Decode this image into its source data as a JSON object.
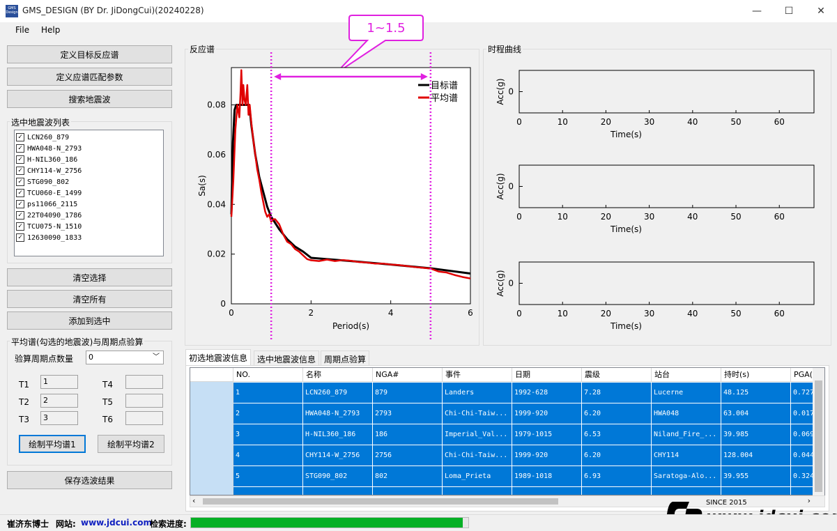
{
  "window": {
    "title": "GMS_DESIGN (BY Dr. JiDongCui)(20240228)",
    "icon_text": "GMS Design",
    "minimize": "—",
    "maximize": "☐",
    "close": "✕"
  },
  "menu": {
    "file": "File",
    "help": "Help"
  },
  "left_panel": {
    "btn_define_target": "定义目标反应谱",
    "btn_define_params": "定义应谱匹配参数",
    "btn_search": "搜索地震波",
    "list_title": "选中地震波列表",
    "waves": [
      "LCN260_879",
      "HWA048-N_2793",
      "H-NIL360_186",
      "CHY114-W_2756",
      "STG090_802",
      "TCU060-E_1499",
      "ps11066_2115",
      "22T04090_1786",
      "TCU075-N_1510",
      "12630090_1833"
    ],
    "btn_clear_selection": "清空选择",
    "btn_clear_all": "清空所有",
    "btn_add_to_selected": "添加到选中",
    "check_group_title": "平均谱(勾选的地震波)与周期点验算",
    "period_count_label": "验算周期点数量",
    "period_count_value": "0",
    "t1_label": "T1",
    "t1_value": "1",
    "t2_label": "T2",
    "t2_value": "2",
    "t3_label": "T3",
    "t3_value": "3",
    "t4_label": "T4",
    "t4_value": "",
    "t5_label": "T5",
    "t5_value": "",
    "t6_label": "T6",
    "t6_value": "",
    "btn_draw_avg1": "绘制平均谱1",
    "btn_draw_avg2": "绘制平均谱2",
    "btn_save": "保存选波结果"
  },
  "spectrum_panel": {
    "title": "反应谱",
    "callout": "1~1.5"
  },
  "chart_data": [
    {
      "type": "line",
      "xlabel": "Period(s)",
      "ylabel": "Sa(s)",
      "xlim": [
        0,
        6
      ],
      "ylim": [
        0,
        0.095
      ],
      "xticks": [
        "0",
        "2",
        "4",
        "6"
      ],
      "yticks": [
        "0",
        "0.02",
        "0.04",
        "0.06",
        "0.08"
      ],
      "legend_position": "top-right",
      "series": [
        {
          "name": "目标谱",
          "color": "#000000",
          "x": [
            0,
            0.04,
            0.08,
            0.12,
            0.2,
            0.45,
            0.5,
            0.6,
            0.7,
            0.8,
            0.9,
            1.0,
            1.2,
            1.4,
            1.6,
            1.8,
            2.0,
            3.0,
            4.0,
            5.0,
            6.0
          ],
          "y": [
            0.036,
            0.065,
            0.078,
            0.08,
            0.08,
            0.08,
            0.072,
            0.06,
            0.051,
            0.045,
            0.039,
            0.035,
            0.03,
            0.026,
            0.023,
            0.021,
            0.0185,
            0.0172,
            0.0158,
            0.0143,
            0.0122
          ]
        },
        {
          "name": "平均谱",
          "color": "#e00000",
          "x": [
            0,
            0.05,
            0.1,
            0.15,
            0.2,
            0.23,
            0.25,
            0.28,
            0.3,
            0.33,
            0.36,
            0.4,
            0.43,
            0.46,
            0.5,
            0.55,
            0.6,
            0.65,
            0.7,
            0.75,
            0.8,
            0.85,
            0.9,
            0.95,
            1.0,
            1.05,
            1.1,
            1.2,
            1.3,
            1.4,
            1.5,
            1.6,
            1.7,
            1.8,
            1.9,
            2.0,
            2.2,
            2.4,
            2.6,
            2.8,
            3.0,
            3.2,
            3.4,
            3.6,
            3.8,
            4.0,
            4.2,
            4.4,
            4.6,
            4.8,
            5.0,
            5.2,
            5.4,
            5.6,
            5.8,
            6.0
          ],
          "y": [
            0.035,
            0.05,
            0.07,
            0.08,
            0.075,
            0.085,
            0.094,
            0.08,
            0.088,
            0.082,
            0.08,
            0.088,
            0.076,
            0.08,
            0.073,
            0.066,
            0.06,
            0.054,
            0.05,
            0.045,
            0.041,
            0.037,
            0.035,
            0.036,
            0.033,
            0.034,
            0.034,
            0.032,
            0.028,
            0.025,
            0.024,
            0.022,
            0.021,
            0.0195,
            0.018,
            0.0175,
            0.0172,
            0.0178,
            0.0172,
            0.0176,
            0.0173,
            0.0168,
            0.0166,
            0.0162,
            0.0162,
            0.0158,
            0.0156,
            0.0152,
            0.0148,
            0.0145,
            0.0142,
            0.013,
            0.0126,
            0.0116,
            0.0108,
            0.0102
          ]
        }
      ],
      "vertical_markers": [
        1,
        5
      ]
    }
  ],
  "time_panel": {
    "title": "时程曲线",
    "plots": [
      {
        "ylabel": "Acc(g)",
        "xlabel": "Time(s)",
        "ytick": "0",
        "xticks": [
          "0",
          "10",
          "20",
          "30",
          "40",
          "50",
          "60"
        ]
      },
      {
        "ylabel": "Acc(g)",
        "xlabel": "Time(s)",
        "ytick": "0",
        "xticks": [
          "0",
          "10",
          "20",
          "30",
          "40",
          "50",
          "60"
        ]
      },
      {
        "ylabel": "Acc(g)",
        "xlabel": "Time(s)",
        "ytick": "0",
        "xticks": [
          "0",
          "10",
          "20",
          "30",
          "40",
          "50",
          "60"
        ]
      }
    ]
  },
  "tabs": [
    "初选地震波信息",
    "选中地震波信息",
    "周期点验算"
  ],
  "table": {
    "columns": [
      "NO.",
      "名称",
      "NGA#",
      "事件",
      "日期",
      "震级",
      "站台",
      "持时(s)",
      "PGA("
    ],
    "rows": [
      [
        "1",
        "LCN260_879",
        "879",
        "Landers",
        "1992-628",
        "7.28",
        "Lucerne",
        "48.125",
        "0.727"
      ],
      [
        "2",
        "HWA048-N_2793",
        "2793",
        "Chi-Chi-Taiw...",
        "1999-920",
        "6.20",
        "HWA048",
        "63.004",
        "0.017"
      ],
      [
        "3",
        "H-NIL360_186",
        "186",
        "Imperial_Val...",
        "1979-1015",
        "6.53",
        "Niland_Fire_...",
        "39.985",
        "0.069"
      ],
      [
        "4",
        "CHY114-W_2756",
        "2756",
        "Chi-Chi-Taiw...",
        "1999-920",
        "6.20",
        "CHY114",
        "128.004",
        "0.044"
      ],
      [
        "5",
        "STG090_802",
        "802",
        "Loma_Prieta",
        "1989-1018",
        "6.93",
        "Saratoga-Alo...",
        "39.955",
        "0.324"
      ]
    ]
  },
  "status": {
    "author": "崔济东博士",
    "site_label": "网站:",
    "site_url": "www.jdcui.com",
    "progress_label": "检索进度:",
    "progress_fraction": 0.98
  },
  "watermark": {
    "since": "SINCE 2015",
    "url": "www.jdcui.com"
  }
}
